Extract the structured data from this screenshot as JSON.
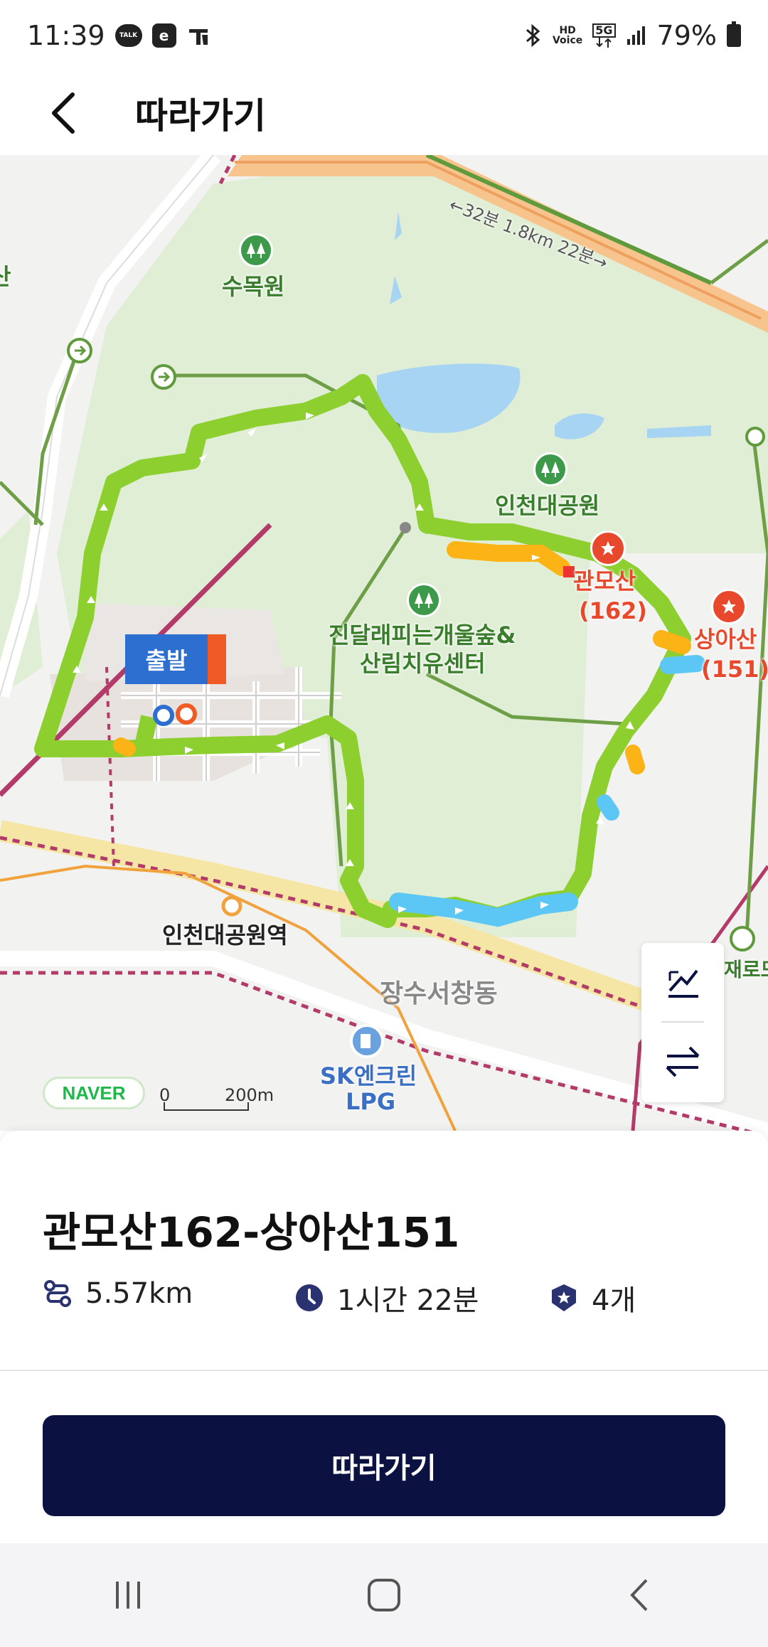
{
  "status_bar": {
    "time": "11:39",
    "talk_icon_text": "TALK",
    "battery": "79%",
    "hd_voice_text": "HD\nVoice",
    "fiveg_text": "5G"
  },
  "header": {
    "title": "따라가기"
  },
  "map": {
    "road_label": "←32분 1.8km 22분→",
    "labels": {
      "arboretum": "수목원",
      "park": "인천대공원",
      "forest_center_line1": "진달래피는개울숲&",
      "forest_center_line2": "산림치유센터",
      "gwanmo_name": "관모산",
      "gwanmo_height": "(162)",
      "sanga_name": "상아산",
      "sanga_height": "(151)",
      "station": "인천대공원역",
      "district": "장수서창동",
      "gas_line1": "SK엔크린",
      "gas_line2": "LPG",
      "edge_left": "산",
      "edge_right": "재로모"
    },
    "start_label": "출발",
    "naver_logo": "NAVER",
    "scale_zero": "0",
    "scale_dist": "200m"
  },
  "route": {
    "title": "관모산162-상아산151",
    "distance": "5.57km",
    "duration": "1시간 22분",
    "peaks": "4개"
  },
  "follow_button": "따라가기",
  "colors": {
    "primary_dark": "#0b1140",
    "route_green": "#8ccf2f",
    "route_orange": "#fbb316",
    "route_blue": "#5cc6f5",
    "peak_red": "#e8482c"
  }
}
